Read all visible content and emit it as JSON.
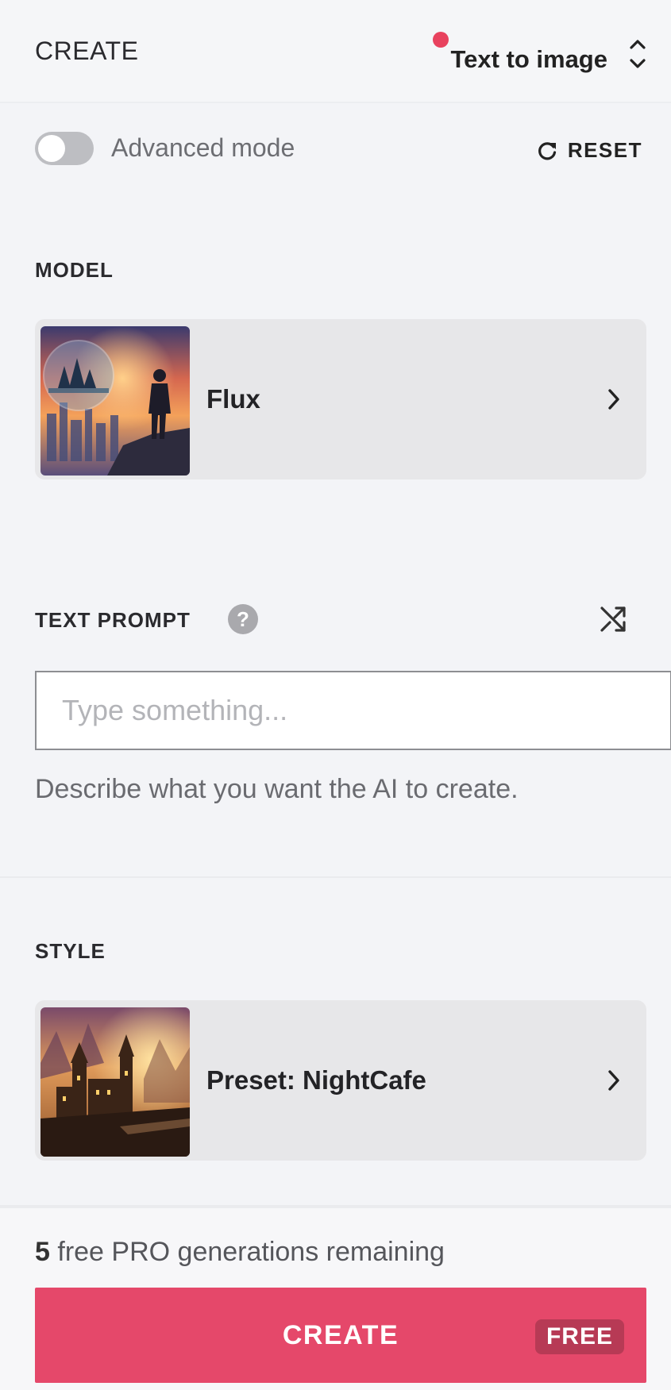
{
  "header": {
    "title": "CREATE",
    "mode_selector": "Text to image",
    "accent": "#e8425e"
  },
  "settings": {
    "advanced_mode_label": "Advanced mode",
    "advanced_mode_on": false,
    "reset_label": "RESET"
  },
  "model": {
    "section_label": "MODEL",
    "selected": "Flux"
  },
  "prompt": {
    "section_label": "TEXT PROMPT",
    "help_icon": "?",
    "placeholder": "Type something...",
    "value": "",
    "helper_text": "Describe what you want the AI to create."
  },
  "style": {
    "section_label": "STYLE",
    "selected": "Preset: NightCafe"
  },
  "footer": {
    "remaining_count": "5",
    "remaining_text": "free PRO generations remaining",
    "create_label": "CREATE",
    "badge": "FREE",
    "button_color": "#e5486a"
  },
  "icons": {
    "mode_selector": "chevron-up-down-icon",
    "reset": "refresh-icon",
    "help": "question-circle-icon",
    "shuffle": "shuffle-icon",
    "card": "chevron-right-icon"
  }
}
